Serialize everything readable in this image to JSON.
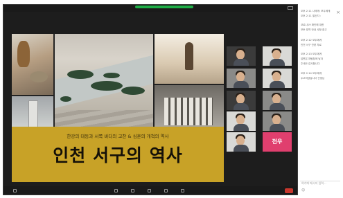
{
  "slide": {
    "subtitle": "한강의 대동과 서쪽 바다의 고찬 & 심훈의 개척의 역사",
    "title": "인천 서구의 역사"
  },
  "participants": [
    {
      "label": ""
    },
    {
      "label": ""
    },
    {
      "label": ""
    },
    {
      "label": ""
    },
    {
      "label": ""
    },
    {
      "label": ""
    },
    {
      "label": ""
    },
    {
      "label": ""
    },
    {
      "label": "",
      "name": "전우"
    },
    {
      "label": ""
    }
  ],
  "chat": {
    "lines": [
      "오후 2:11 나에게: 모두에게",
      "오후 2:11 발신자 :",
      "코로나19 확인에 대한",
      "모든 방역 안내 사항 참고",
      "오후 2:12 모두에게",
      "인천 서구 관련 자료",
      "오후 2:13 모두에게",
      "답변은 채팅창에 남겨",
      "주세요 감사합니다",
      "오후 2:14 모두에게",
      "수고하셨습니다 선생님"
    ],
    "placeholder": "여기에 메시지 입력..."
  },
  "colors": {
    "window_bg": "#1d1d1d",
    "banner": "#c8a227",
    "green_pill": "#1fae47",
    "leave_button": "#c8372d"
  },
  "icons": [
    "view-icon",
    "close-icon",
    "mic-icon",
    "video-icon",
    "participants-icon",
    "chat-icon",
    "share-icon",
    "record-icon"
  ]
}
